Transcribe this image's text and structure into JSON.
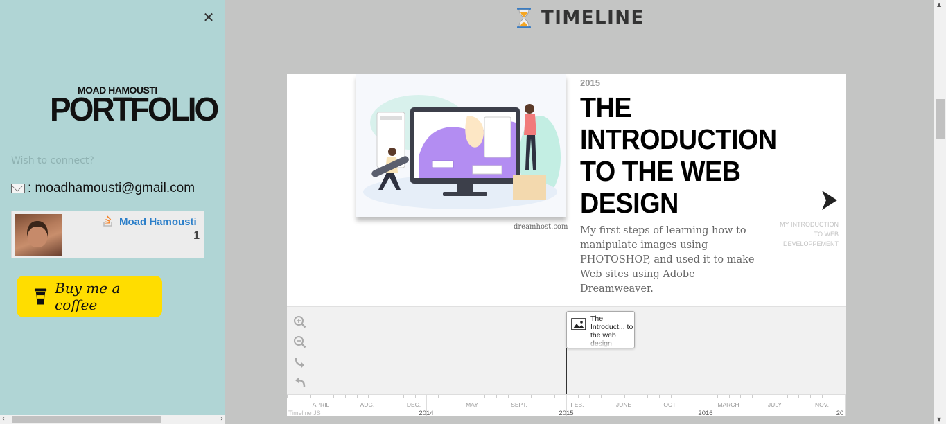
{
  "sidebar": {
    "close_glyph": "✕",
    "logo_line1": "MOAD HAMOUSTI",
    "logo_line2": "PORTFOLIO",
    "connect_label": "Wish to connect?",
    "email_text": ": moadhamousti@gmail.com",
    "stackoverflow": {
      "name": "Moad Hamousti",
      "reputation": "1"
    },
    "coffee_label": "Buy me a coffee"
  },
  "header": {
    "title": "TIMELINE",
    "icon": "hourglass-icon"
  },
  "slide": {
    "year": "2015",
    "headline": "THE INTRODUCTION TO THE WEB DESIGN",
    "text": "My first steps of learning how to manipulate images using PHOTOSHOP, and used it to make Web sites using Adobe Dreamweaver.",
    "media_credit": "dreamhost.com",
    "next_label": "MY INTRODUCTION TO WEB DEVELOPPEMENT"
  },
  "nav": {
    "marker_text": "The Introduct... to the web design",
    "months": [
      "APRIL",
      "AUG.",
      "DEC.",
      "MAY",
      "SEPT.",
      "FEB.",
      "JUNE",
      "OCT.",
      "MARCH",
      "JULY",
      "NOV."
    ],
    "years": [
      "2014",
      "2015",
      "2016",
      "20"
    ],
    "credit": "Timeline JS"
  },
  "colors": {
    "sidebar_bg": "#b0d5d5",
    "coffee_bg": "#ffdd00",
    "page_bg": "#c4c5c4",
    "so_link": "#2c7fc9"
  }
}
